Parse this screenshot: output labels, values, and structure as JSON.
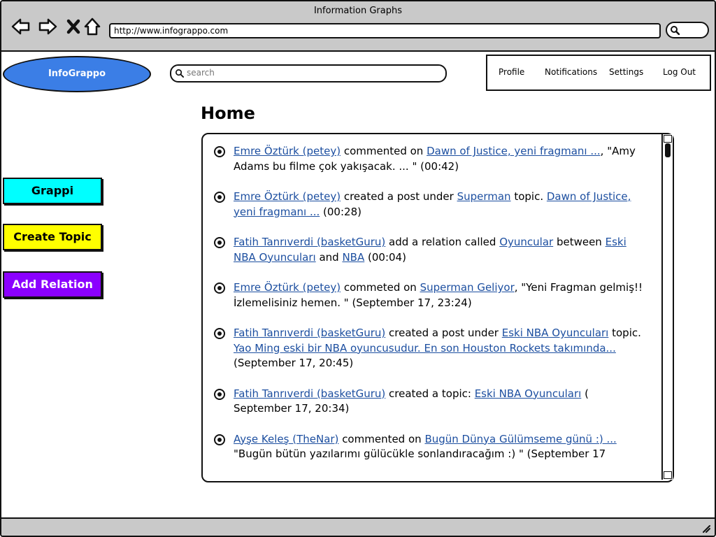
{
  "window": {
    "title": "Information Graphs",
    "url": "http://www.infograppo.com"
  },
  "icons": {
    "back": "back-arrow-icon",
    "forward": "forward-arrow-icon",
    "stop": "close-icon",
    "home": "home-icon",
    "search": "search-icon",
    "resize": "resize-grip-icon"
  },
  "header": {
    "logo": "InfoGrappo",
    "search_placeholder": "search",
    "menu": {
      "profile": "Profile",
      "notifications": "Notifications",
      "settings": "Settings",
      "logout": "Log Out"
    }
  },
  "sidebar": {
    "buttons": [
      {
        "label": "Grappi",
        "color": "#00ffff"
      },
      {
        "label": "Create Topic",
        "color": "#ffff00"
      },
      {
        "label": "Add Relation",
        "color": "#8b00ff"
      }
    ]
  },
  "main": {
    "title": "Home",
    "feed": [
      {
        "segments": [
          {
            "text": "Emre Öztürk (petey)",
            "link": true
          },
          {
            "text": " commented on ",
            "link": false
          },
          {
            "text": "Dawn of Justice, yeni fragmanı ...",
            "link": true
          },
          {
            "text": ", \"Amy Adams bu filme çok yakışacak. ... \" (00:42)",
            "link": false
          }
        ]
      },
      {
        "segments": [
          {
            "text": "Emre Öztürk (petey)",
            "link": true
          },
          {
            "text": " created a post under ",
            "link": false
          },
          {
            "text": "Superman",
            "link": true
          },
          {
            "text": " topic. ",
            "link": false
          },
          {
            "text": "Dawn of Justice, yeni fragmanı ...",
            "link": true
          },
          {
            "text": " (00:28)",
            "link": false
          }
        ]
      },
      {
        "segments": [
          {
            "text": "Fatih Tanrıverdi (basketGuru)",
            "link": true
          },
          {
            "text": " add a relation called ",
            "link": false
          },
          {
            "text": "Oyuncular",
            "link": true
          },
          {
            "text": " between ",
            "link": false
          },
          {
            "text": "Eski NBA Oyuncuları",
            "link": true
          },
          {
            "text": " and ",
            "link": false
          },
          {
            "text": "NBA",
            "link": true
          },
          {
            "text": " (00:04)",
            "link": false
          }
        ]
      },
      {
        "segments": [
          {
            "text": "Emre Öztürk (petey)",
            "link": true
          },
          {
            "text": " commeted on ",
            "link": false
          },
          {
            "text": "Superman Geliyor",
            "link": true
          },
          {
            "text": ", \"Yeni Fragman gelmiş!! İzlemelisiniz hemen. \" (September 17, 23:24)",
            "link": false
          }
        ]
      },
      {
        "segments": [
          {
            "text": "Fatih Tanrıverdi (basketGuru)",
            "link": true
          },
          {
            "text": " created a post under ",
            "link": false
          },
          {
            "text": "Eski NBA Oyuncuları",
            "link": true
          },
          {
            "text": " topic. ",
            "link": false
          },
          {
            "text": "Yao Ming eski bir NBA oyuncusudur. En son Houston Rockets takımında...",
            "link": true
          },
          {
            "text": " (September 17, 20:45)",
            "link": false
          }
        ]
      },
      {
        "segments": [
          {
            "text": "Fatih Tanrıverdi (basketGuru)",
            "link": true
          },
          {
            "text": " created a topic: ",
            "link": false
          },
          {
            "text": "Eski NBA Oyuncuları",
            "link": true
          },
          {
            "text": " ( September 17, 20:34)",
            "link": false
          }
        ]
      },
      {
        "segments": [
          {
            "text": "Ayşe Keleş (TheNar)",
            "link": true
          },
          {
            "text": " commented on ",
            "link": false
          },
          {
            "text": "Bugün Dünya Gülümseme günü :) ...",
            "link": true
          },
          {
            "text": " \"Bugün bütün yazılarımı gülücükle sonlandıracağım :) \" (September 17",
            "link": false
          }
        ]
      }
    ]
  }
}
